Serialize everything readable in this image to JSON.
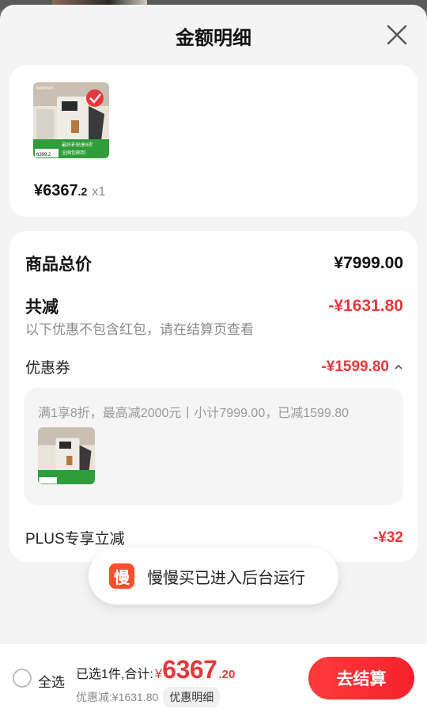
{
  "header": {
    "title": "金额明细"
  },
  "product": {
    "price_int": "¥6367",
    "price_dec": ".2",
    "qty": "x1",
    "thumb_badge_top": "最好补贴享8折",
    "thumb_badge_bottom": "全国包邮到",
    "thumb_brand": "bewinch",
    "thumb_price": "6399.2"
  },
  "breakdown": {
    "total_label": "商品总价",
    "total_value": "¥7999.00",
    "reduce_label": "共减",
    "reduce_value": "-¥1631.80",
    "reduce_note": "以下优惠不包含红包，请在结算页查看",
    "coupon_label": "优惠券",
    "coupon_value": "-¥1599.80",
    "coupon_desc": "满1享8折，最高减2000元丨小计7999.00，已减1599.80",
    "plus_label": "PLUS专享立减",
    "plus_value": "-¥32"
  },
  "toast": {
    "icon_char": "慢",
    "text": "慢慢买已进入后台运行"
  },
  "bottom": {
    "select_all": "全选",
    "summary_prefix": "已选1件,合计:",
    "total_currency": "¥",
    "total_int": "6367",
    "total_dec": ".20",
    "discount_text": "优惠减:¥1631.80",
    "detail_chip": "优惠明细",
    "checkout": "去结算"
  },
  "colors": {
    "accent_red": "#e4393c",
    "checkout_red": "#f5222d",
    "sheet_bg": "#f4f4f4"
  }
}
